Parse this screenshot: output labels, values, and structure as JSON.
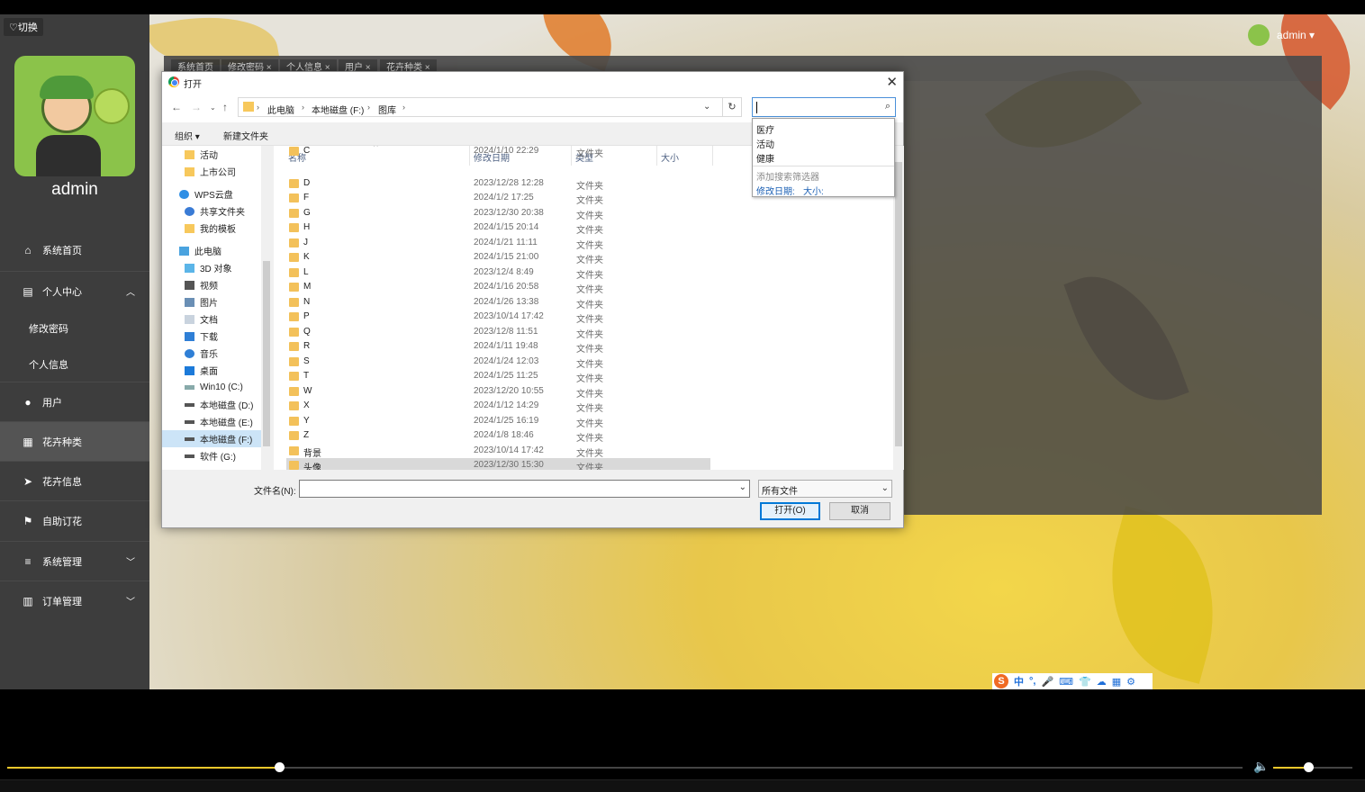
{
  "app": {
    "switch_label": "♡切换",
    "admin_name": "admin",
    "top_user": "admin ▾",
    "sidebar": [
      {
        "label": "系统首页",
        "icon": "home-icon"
      },
      {
        "label": "个人中心",
        "icon": "calendar-icon"
      },
      {
        "label": "修改密码",
        "sub": true
      },
      {
        "label": "个人信息",
        "sub": true
      },
      {
        "label": "用户",
        "icon": "bulb-icon"
      },
      {
        "label": "花卉种类",
        "icon": "grid-icon"
      },
      {
        "label": "花卉信息",
        "icon": "send-icon"
      },
      {
        "label": "自助订花",
        "icon": "flag-icon"
      },
      {
        "label": "系统管理",
        "icon": "list-icon"
      },
      {
        "label": "订单管理",
        "icon": "bar-chart-icon"
      }
    ],
    "tabs": [
      "系统首页",
      "修改密码 ×",
      "个人信息 ×",
      "用户 ×",
      "花卉种类 ×"
    ]
  },
  "dialog": {
    "title": "打开",
    "breadcrumb": [
      "此电脑",
      "本地磁盘 (F:)",
      "图库"
    ],
    "toolbar": {
      "organize": "组织 ▾",
      "new_folder": "新建文件夹"
    },
    "nav_items": [
      {
        "label": "活动",
        "icon": "folder-icon"
      },
      {
        "label": "上市公司",
        "icon": "folder-icon"
      },
      {
        "label": "WPS云盘",
        "icon": "cloud-icon"
      },
      {
        "label": "共享文件夹",
        "icon": "share-icon"
      },
      {
        "label": "我的模板",
        "icon": "folder-icon"
      },
      {
        "label": "此电脑",
        "icon": "computer-icon"
      },
      {
        "label": "3D 对象",
        "icon": "cube-icon"
      },
      {
        "label": "视频",
        "icon": "video-icon"
      },
      {
        "label": "图片",
        "icon": "picture-icon"
      },
      {
        "label": "文档",
        "icon": "document-icon"
      },
      {
        "label": "下载",
        "icon": "download-icon"
      },
      {
        "label": "音乐",
        "icon": "music-icon"
      },
      {
        "label": "桌面",
        "icon": "desktop-icon"
      },
      {
        "label": "Win10 (C:)",
        "icon": "drive-icon"
      },
      {
        "label": "本地磁盘 (D:)",
        "icon": "drive-icon"
      },
      {
        "label": "本地磁盘 (E:)",
        "icon": "drive-icon"
      },
      {
        "label": "本地磁盘 (F:)",
        "icon": "drive-icon"
      },
      {
        "label": "软件 (G:)",
        "icon": "drive-icon"
      }
    ],
    "columns": [
      "名称",
      "修改日期",
      "类型",
      "大小"
    ],
    "files": [
      {
        "name": "C",
        "date": "2024/1/10 22:29",
        "type": "文件夹"
      },
      {
        "name": "D",
        "date": "2023/12/28 12:28",
        "type": "文件夹"
      },
      {
        "name": "F",
        "date": "2024/1/2 17:25",
        "type": "文件夹"
      },
      {
        "name": "G",
        "date": "2023/12/30 20:38",
        "type": "文件夹"
      },
      {
        "name": "H",
        "date": "2024/1/15 20:14",
        "type": "文件夹"
      },
      {
        "name": "J",
        "date": "2024/1/21 11:11",
        "type": "文件夹"
      },
      {
        "name": "K",
        "date": "2024/1/15 21:00",
        "type": "文件夹"
      },
      {
        "name": "L",
        "date": "2023/12/4 8:49",
        "type": "文件夹"
      },
      {
        "name": "M",
        "date": "2024/1/16 20:58",
        "type": "文件夹"
      },
      {
        "name": "N",
        "date": "2024/1/26 13:38",
        "type": "文件夹"
      },
      {
        "name": "P",
        "date": "2023/10/14 17:42",
        "type": "文件夹"
      },
      {
        "name": "Q",
        "date": "2023/12/8 11:51",
        "type": "文件夹"
      },
      {
        "name": "R",
        "date": "2024/1/11 19:48",
        "type": "文件夹"
      },
      {
        "name": "S",
        "date": "2024/1/24 12:03",
        "type": "文件夹"
      },
      {
        "name": "T",
        "date": "2024/1/25 11:25",
        "type": "文件夹"
      },
      {
        "name": "W",
        "date": "2023/12/20 10:55",
        "type": "文件夹"
      },
      {
        "name": "X",
        "date": "2024/1/12 14:29",
        "type": "文件夹"
      },
      {
        "name": "Y",
        "date": "2024/1/25 16:19",
        "type": "文件夹"
      },
      {
        "name": "Z",
        "date": "2024/1/8 18:46",
        "type": "文件夹"
      },
      {
        "name": "背景",
        "date": "2023/10/14 17:42",
        "type": "文件夹"
      },
      {
        "name": "头像",
        "date": "2023/12/30 15:30",
        "type": "文件夹"
      }
    ],
    "search_suggestions": [
      "医疗",
      "活动",
      "健康"
    ],
    "search_hint": "添加搜索筛选器",
    "search_filters": [
      "修改日期:",
      "大小:"
    ],
    "filename_label": "文件名(N):",
    "filename_value": "",
    "filter_value": "所有文件",
    "open_label": "打开(O)",
    "cancel_label": "取消"
  },
  "ime": [
    "中",
    "°,",
    "🎤",
    "⌨",
    "👕",
    "☁",
    "▦",
    "⚙"
  ],
  "player": {
    "progress": 0.22,
    "volume": 0.44
  }
}
